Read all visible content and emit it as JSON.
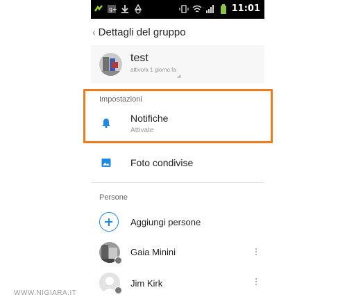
{
  "status_bar": {
    "time": "11:01"
  },
  "header": {
    "back_label": "‹",
    "title": "Dettagli del gruppo"
  },
  "group": {
    "name": "test",
    "status": "attivo/a 1 giorno fa"
  },
  "settings": {
    "section_label": "Impostazioni",
    "notifications": {
      "title": "Notifiche",
      "subtitle": "Attivate",
      "icon": "bell-icon"
    },
    "shared_photos": {
      "title": "Foto condivise",
      "icon": "image-icon"
    }
  },
  "people": {
    "section_label": "Persone",
    "add_label": "Aggiungi persone",
    "members": [
      {
        "name": "Gaia Minini"
      },
      {
        "name": "Jim Kirk"
      }
    ]
  },
  "colors": {
    "accent": "#1e88e5",
    "highlight": "#f07b1e"
  },
  "watermark": "WWW.NIGIARA.IT"
}
